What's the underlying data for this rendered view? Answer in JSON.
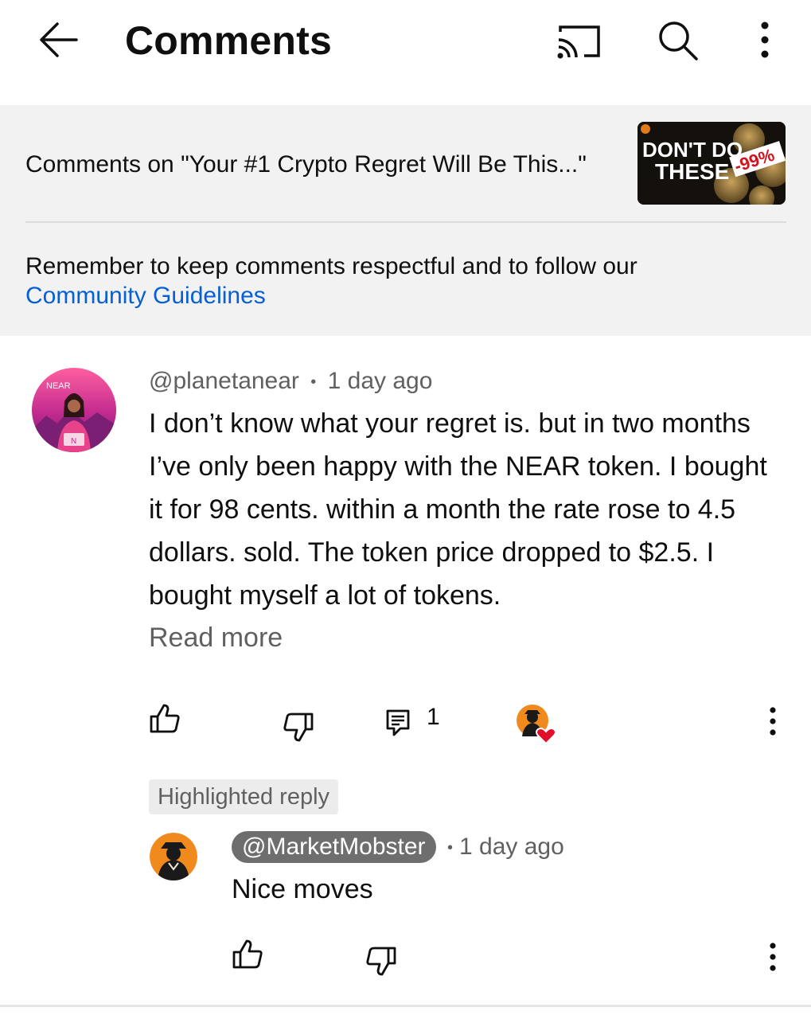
{
  "header": {
    "title": "Comments",
    "back_icon": "arrow-left-icon",
    "cast_icon": "cast-icon",
    "search_icon": "search-icon",
    "more_icon": "more-vert-icon"
  },
  "video_info": {
    "comments_on": "Comments on \"Your #1 Crypto Regret Will Be This...\"",
    "thumbnail": {
      "line1": "DON'T DO",
      "line2": "THESE",
      "badge": "-99%"
    }
  },
  "guidelines": {
    "text": "Remember to keep comments respectful and to follow our",
    "link": "Community Guidelines"
  },
  "comment": {
    "author": "@planetanear",
    "separator": "•",
    "time": "1 day ago",
    "avatar_label": "NEAR",
    "body": "I don’t know what your regret is. but in two months I’ve only been happy with the NEAR token. I bought it for 98 cents. within a month the rate rose to 4.5 dollars. sold. The token price dropped to $2.5. I bought myself a lot of tokens.",
    "read_more": "Read more",
    "reply_count": "1",
    "icons": {
      "like": "thumbs-up-icon",
      "dislike": "thumbs-down-icon",
      "reply": "comment-reply-icon",
      "creator_heart": "creator-heart-icon",
      "more": "more-vert-icon"
    }
  },
  "highlighted_reply": {
    "label": "Highlighted reply",
    "author": "@MarketMobster",
    "separator": "•",
    "time": "1 day ago",
    "body": "Nice moves"
  },
  "colors": {
    "link": "#065fd4",
    "panel_bg": "#f2f2f2",
    "secondary_text": "#606060",
    "heart": "#e0102a",
    "author_chip": "#6e6e6e"
  }
}
